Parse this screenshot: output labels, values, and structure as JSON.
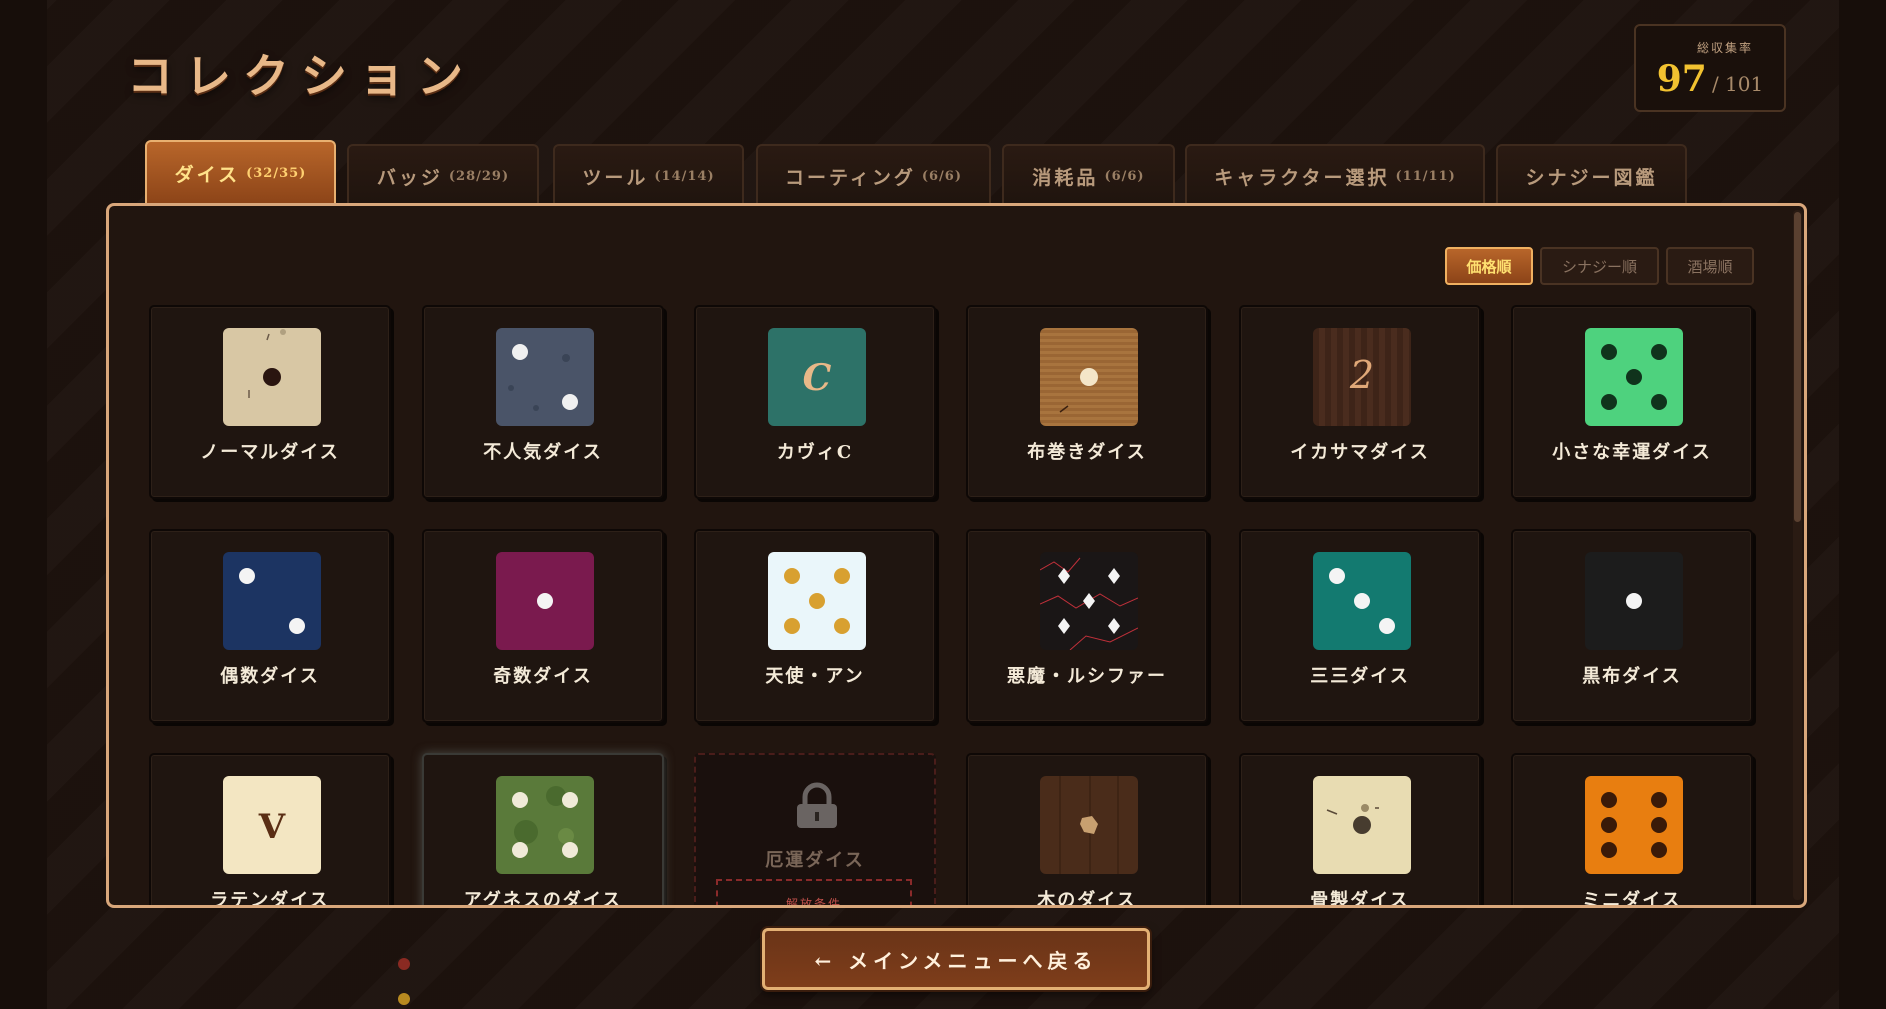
{
  "header": {
    "title": "コレクション",
    "rate_label": "総収集率",
    "rate_value": "97",
    "rate_total": "/ 101"
  },
  "tabs": [
    {
      "label": "ダイス",
      "count": "(32/35)"
    },
    {
      "label": "バッジ",
      "count": "(28/29)"
    },
    {
      "label": "ツール",
      "count": "(14/14)"
    },
    {
      "label": "コーティング",
      "count": "(6/6)"
    },
    {
      "label": "消耗品",
      "count": "(6/6)"
    },
    {
      "label": "キャラクター選択",
      "count": "(11/11)"
    },
    {
      "label": "シナジー図鑑",
      "count": ""
    }
  ],
  "sort": [
    "価格順",
    "シナジー順",
    "酒場順"
  ],
  "cards": [
    {
      "name": "ノーマルダイス",
      "icon": "normal-die-icon"
    },
    {
      "name": "不人気ダイス",
      "icon": "unpopular-die-icon"
    },
    {
      "name": "カヴィC",
      "icon": "letter-c-die-icon",
      "glyph": "C"
    },
    {
      "name": "布巻きダイス",
      "icon": "cloth-die-icon"
    },
    {
      "name": "イカサマダイス",
      "icon": "cheat-die-icon",
      "glyph": "2"
    },
    {
      "name": "小さな幸運ダイス",
      "icon": "lucky-die-icon"
    },
    {
      "name": "偶数ダイス",
      "icon": "even-die-icon"
    },
    {
      "name": "奇数ダイス",
      "icon": "odd-die-icon"
    },
    {
      "name": "天使・アン",
      "icon": "angel-die-icon"
    },
    {
      "name": "悪魔・ルシファー",
      "icon": "devil-die-icon"
    },
    {
      "name": "三三ダイス",
      "icon": "three-three-die-icon"
    },
    {
      "name": "黒布ダイス",
      "icon": "black-cloth-die-icon"
    },
    {
      "name": "ラテンダイス",
      "icon": "latin-die-icon",
      "glyph": "V"
    },
    {
      "name": "アグネスのダイス",
      "icon": "agnes-die-icon"
    },
    {
      "name": "厄運ダイス",
      "icon": "lock-icon",
      "locked": true,
      "unlock_label": "解放条件"
    },
    {
      "name": "木のダイス",
      "icon": "wood-die-icon"
    },
    {
      "name": "骨製ダイス",
      "icon": "bone-die-icon"
    },
    {
      "name": "ミニダイス",
      "icon": "mini-die-icon"
    }
  ],
  "back_button": "← メインメニューへ戻る",
  "colors": {
    "accent": "#d9a77b",
    "active_tab": "#b8662a",
    "gold": "#f2c230"
  }
}
